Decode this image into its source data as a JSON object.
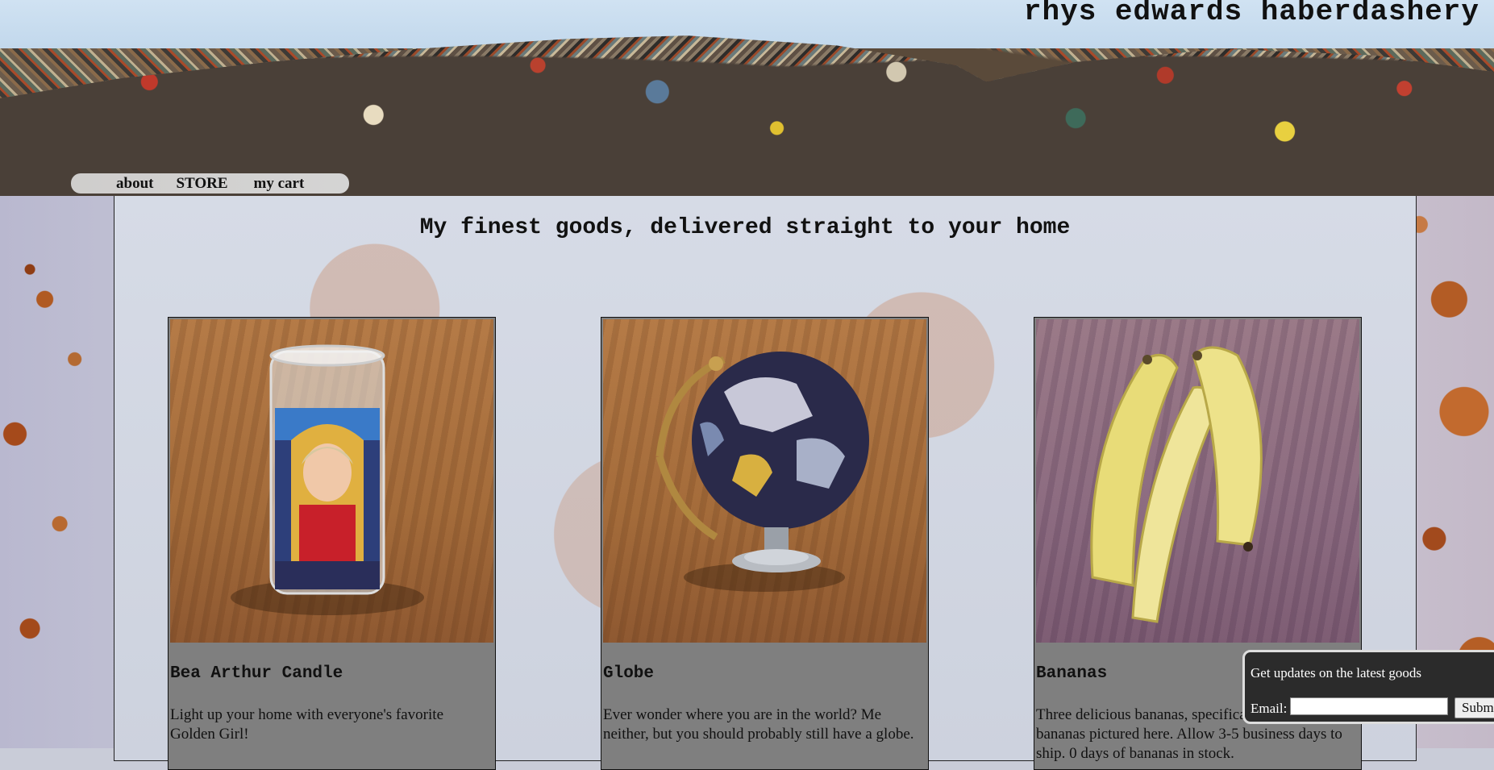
{
  "site": {
    "title": "rhys edwards haberdashery"
  },
  "nav": {
    "items": [
      {
        "label": "about"
      },
      {
        "label": "STORE"
      },
      {
        "label": "my cart"
      }
    ]
  },
  "main": {
    "headline": "My finest goods, delivered straight to your home"
  },
  "products": [
    {
      "name": "Bea Arthur Candle",
      "description": "Light up your home with everyone's favorite Golden Girl!",
      "image": "bea-arthur-candle-photo"
    },
    {
      "name": "Globe",
      "description": "Ever wonder where you are in the world? Me neither, but you should probably still have a globe.",
      "image": "globe-photo"
    },
    {
      "name": "Bananas",
      "description": "Three delicious bananas, specifically the three bananas pictured here. Allow 3-5 business days to ship. 0 days of bananas in stock.",
      "image": "bananas-photo"
    }
  ],
  "newsletter": {
    "title": "Get updates on the latest goods",
    "email_label": "Email:",
    "email_value": "",
    "email_placeholder": "",
    "submit_label": "Submit"
  }
}
